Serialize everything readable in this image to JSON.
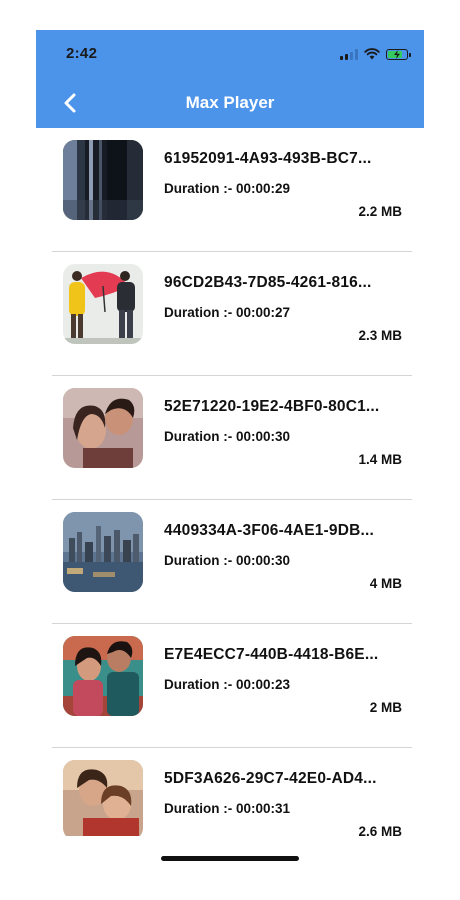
{
  "status_bar": {
    "time": "2:42",
    "icons": [
      "signal-icon",
      "wifi-icon",
      "battery-charging-icon"
    ]
  },
  "nav_bar": {
    "title": "Max Player",
    "back_icon": "chevron-left-icon"
  },
  "videos": [
    {
      "name": "61952091-4A93-493B-BC7...",
      "duration": "Duration :- 00:00:29",
      "size": "2.2 MB"
    },
    {
      "name": "96CD2B43-7D85-4261-816...",
      "duration": "Duration :- 00:00:27",
      "size": "2.3 MB"
    },
    {
      "name": "52E71220-19E2-4BF0-80C1...",
      "duration": "Duration :- 00:00:30",
      "size": "1.4 MB"
    },
    {
      "name": "4409334A-3F06-4AE1-9DB...",
      "duration": "Duration :- 00:00:30",
      "size": "4 MB"
    },
    {
      "name": "E7E4ECC7-440B-4418-B6E...",
      "duration": "Duration :- 00:00:23",
      "size": "2 MB"
    },
    {
      "name": "5DF3A626-29C7-42E0-AD4...",
      "duration": "Duration :- 00:00:31",
      "size": "2.6 MB"
    }
  ],
  "colors": {
    "header": "#4c93ea",
    "title_text": "#ffffff",
    "item_text": "#111111",
    "divider": "#d4d4d4"
  }
}
